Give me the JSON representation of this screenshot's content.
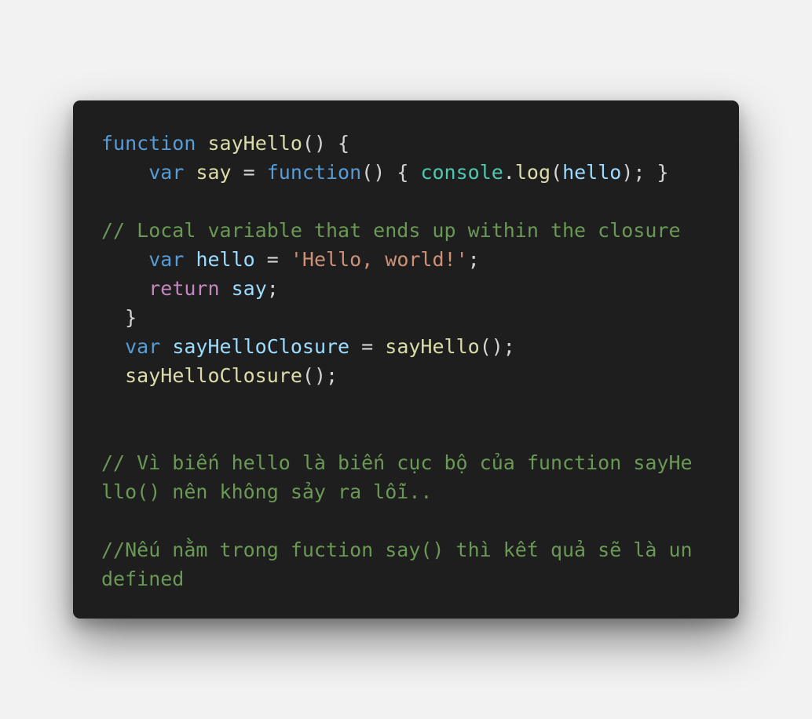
{
  "code": {
    "tokens": {
      "kw_function": "function",
      "kw_var": "var",
      "kw_return": "return",
      "fn_sayHello": "sayHello",
      "fn_log": "log",
      "var_say": "say",
      "var_hello": "hello",
      "var_sayHelloClosure": "sayHelloClosure",
      "cls_console": "console",
      "str_hello_world": "'Hello, world!'"
    },
    "comments": {
      "local_variable": "// Local variable that ends up within the closure",
      "vi_line1": "// Vì biến hello là biến cục bộ của function sayHe",
      "vi_line2": "llo() nên không sảy ra lỗi..",
      "vi_line3": "//Nếu nằm trong fuction say() thì kết quả sẽ là un",
      "vi_line4": "defined"
    }
  }
}
